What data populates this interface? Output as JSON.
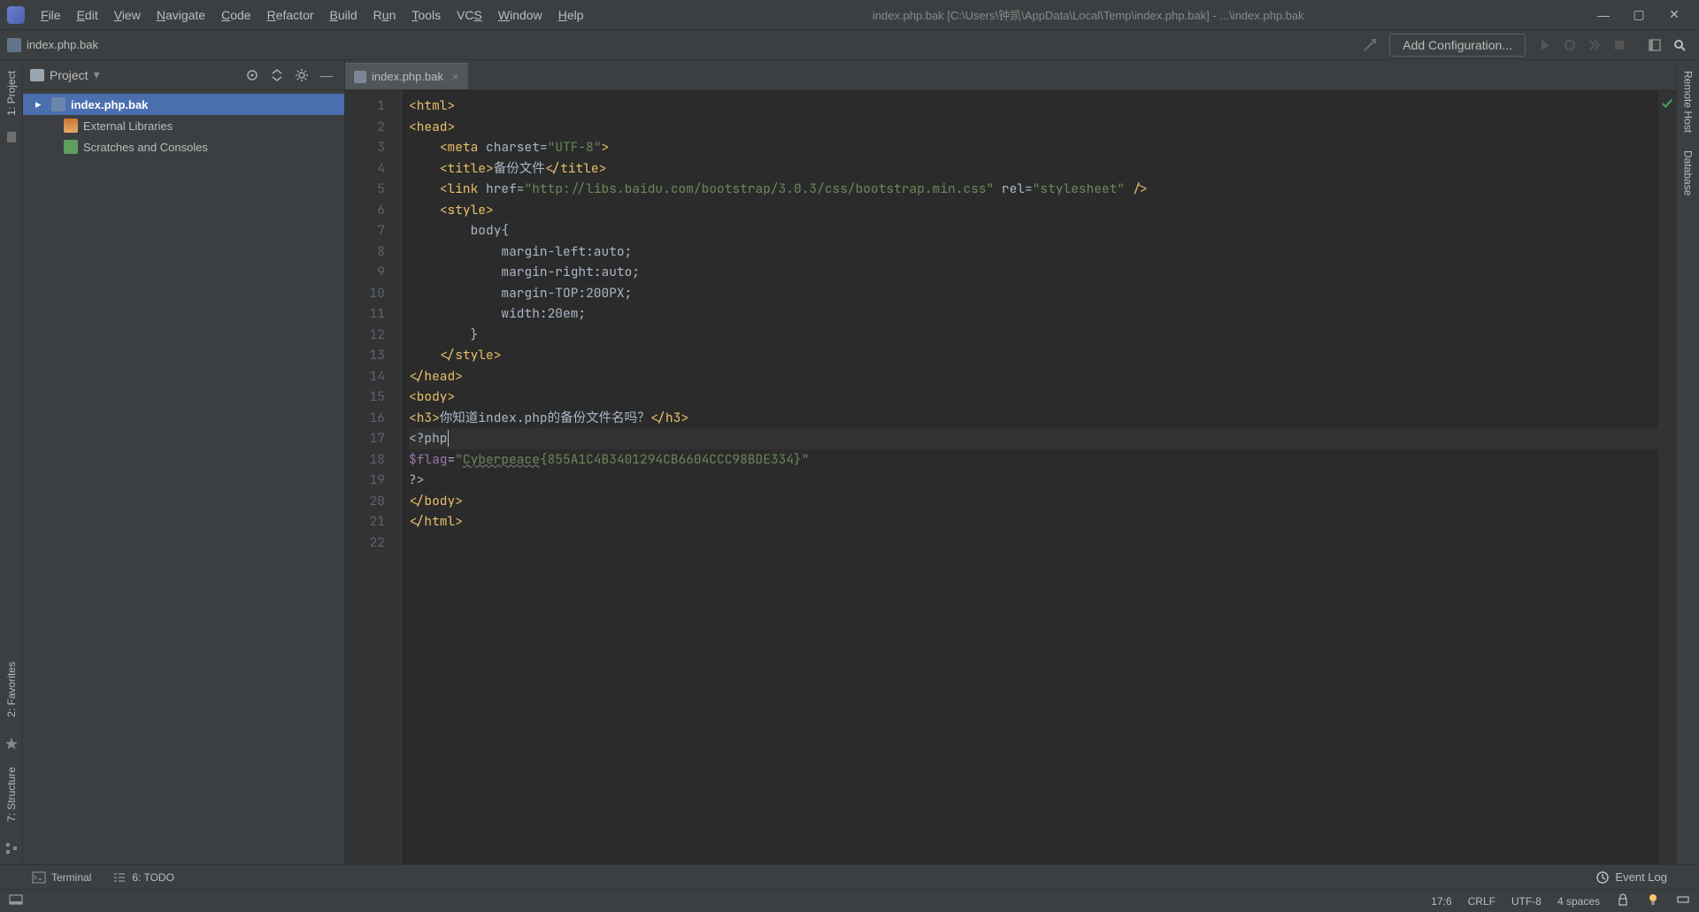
{
  "window": {
    "title": "index.php.bak [C:\\Users\\钟凯\\AppData\\Local\\Temp\\index.php.bak] - ...\\index.php.bak"
  },
  "menu": {
    "file": "File",
    "edit": "Edit",
    "view": "View",
    "navigate": "Navigate",
    "code": "Code",
    "refactor": "Refactor",
    "build": "Build",
    "run": "Run",
    "tools": "Tools",
    "vcs": "VCS",
    "window": "Window",
    "help": "Help"
  },
  "toolbar": {
    "breadcrumb": "index.php.bak",
    "add_config": "Add Configuration..."
  },
  "left_tabs": {
    "project": "1: Project",
    "favorites": "2: Favorites",
    "structure": "7: Structure"
  },
  "right_tabs": {
    "remote_host": "Remote Host",
    "database": "Database"
  },
  "project_panel": {
    "title": "Project",
    "items": [
      {
        "label": "index.php.bak",
        "kind": "folder",
        "selected": true,
        "bold": true
      },
      {
        "label": "External Libraries",
        "kind": "lib",
        "selected": false,
        "bold": false
      },
      {
        "label": "Scratches and Consoles",
        "kind": "scratch",
        "selected": false,
        "bold": false
      }
    ]
  },
  "editor": {
    "tab_label": "index.php.bak",
    "lines": [
      "<html>",
      "<head>",
      "    <meta charset=\"UTF-8\">",
      "    <title>备份文件</title>",
      "    <link href=\"http://libs.baidu.com/bootstrap/3.0.3/css/bootstrap.min.css\" rel=\"stylesheet\" />",
      "    <style>",
      "        body{",
      "            margin-left:auto;",
      "            margin-right:auto;",
      "            margin-TOP:200PX;",
      "            width:20em;",
      "        }",
      "    </style>",
      "</head>",
      "<body>",
      "<h3>你知道index.php的备份文件名吗？</h3>",
      "<?php",
      "$flag=\"Cyberpeace{855A1C4B3401294CB6604CCC98BDE334}\"",
      "?>",
      "</body>",
      "</html>",
      ""
    ],
    "caret_line": 17,
    "caret_col": 6
  },
  "bottom_tabs": {
    "terminal": "Terminal",
    "todo": "6: TODO",
    "event_log": "Event Log"
  },
  "status": {
    "pos": "17:6",
    "line_sep": "CRLF",
    "encoding": "UTF-8",
    "indent": "4 spaces"
  }
}
